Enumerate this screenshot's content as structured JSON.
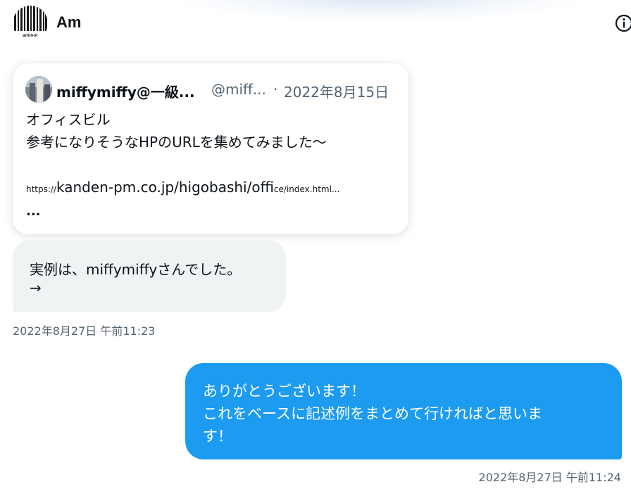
{
  "header": {
    "chat_name": "Am",
    "avatar_text": "aminor",
    "avatar_icon": "barcode-logo-icon",
    "info_icon": "info-icon"
  },
  "quoted_tweet": {
    "author_name": "miffymiffy@一級...",
    "handle": "@miff...",
    "separator": "·",
    "date": "2022年8月15日",
    "text_line1": "オフィスビル",
    "text_line2": "参考になりそうなHPのURLを集めてみました～",
    "url_prefix": "https://",
    "url_main": "kanden-pm.co.jp/higobashi/offi",
    "url_suffix": "ce/index.html...",
    "ellipsis": "..."
  },
  "received_message": {
    "line1": "実例は、miffymiffyさんでした。",
    "line2": "→",
    "timestamp": "2022年8月27日 午前11:23"
  },
  "sent_message": {
    "line1": "ありがとうございます！",
    "line2": "これをベースに記述例をまとめて行ければと思いま",
    "line3": "す！",
    "timestamp": "2022年8月27日 午前11:24"
  },
  "colors": {
    "sent_bubble": "#1d9bf0",
    "received_bubble": "#eff3f4",
    "secondary_text": "#536471",
    "primary_text": "#0f1419"
  }
}
